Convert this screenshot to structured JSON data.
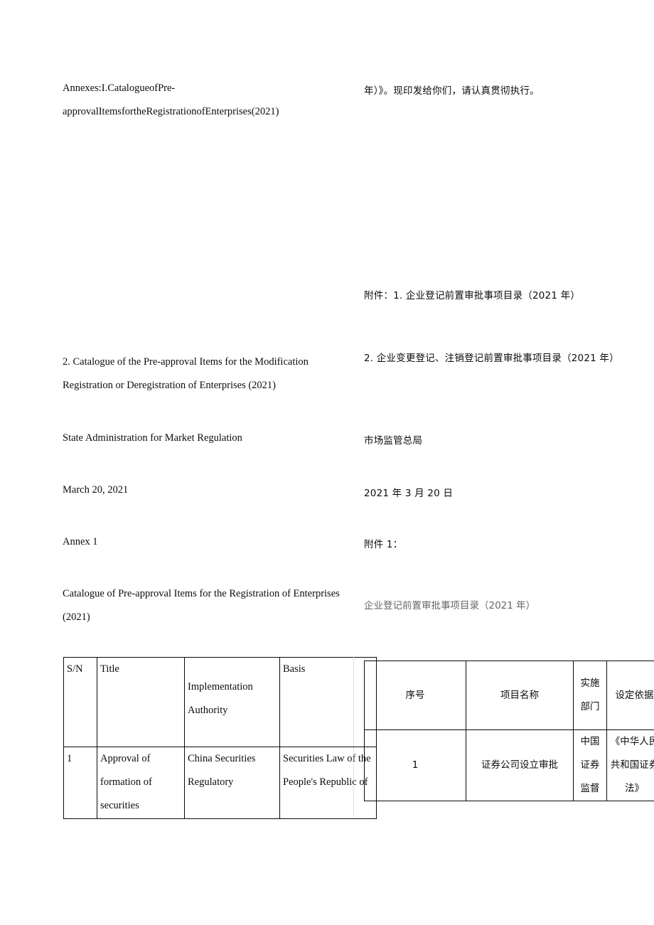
{
  "document": {
    "language_left": "English translation",
    "language_right": "Chinese original"
  },
  "left_column": {
    "annex_list": "Annexes:I.CatalogueofPre-approvalItemsfortheRegistrationofEnterprises(2021)",
    "annex_item_2": "2. Catalogue of the Pre-approval Items for the Modification Registration or Deregistration of Enterprises (2021)",
    "issuer": "State Administration for Market Regulation",
    "date": "March 20, 2021",
    "annex_label": "Annex 1",
    "annex_title": "Catalogue of Pre-approval Items for the Registration of Enterprises (2021)"
  },
  "right_column": {
    "closing_sentence": "年）》。现印发给你们，请认真贯彻执行。",
    "annex_item_1": "附件：1. 企业登记前置审批事项目录（2021 年）",
    "annex_item_2": "2. 企业变更登记、注销登记前置审批事项目录（2021 年）",
    "issuer": "市场监管总局",
    "date": "2021 年 3 月 20 日",
    "annex_label": "附件 1：",
    "annex_title": "企业登记前置审批事项目录（2021 年）"
  },
  "table_en": {
    "headers": [
      "S/N",
      "Title",
      "Implementation Authority",
      "Basis"
    ],
    "rows": [
      {
        "sn": "1",
        "title": "Approval of formation of securities",
        "authority": "China Securities Regulatory",
        "basis": "Securities Law of the People's Republic of",
        "basis_is_link": true
      }
    ]
  },
  "table_zh": {
    "headers": [
      "序号",
      "项目名称",
      "实施部门",
      "设定依据"
    ],
    "rows": [
      {
        "sn": "1",
        "title": "证券公司设立审批",
        "authority": "中国证券监督",
        "basis": "《中华人民共和国证券法》",
        "basis_is_link": true
      }
    ]
  },
  "colors": {
    "text": "#0d0d0d",
    "link": "#5b8fb4",
    "border": "#0a0a0a",
    "background": "#ffffff",
    "overflow_guide": "#b9c4c0"
  }
}
